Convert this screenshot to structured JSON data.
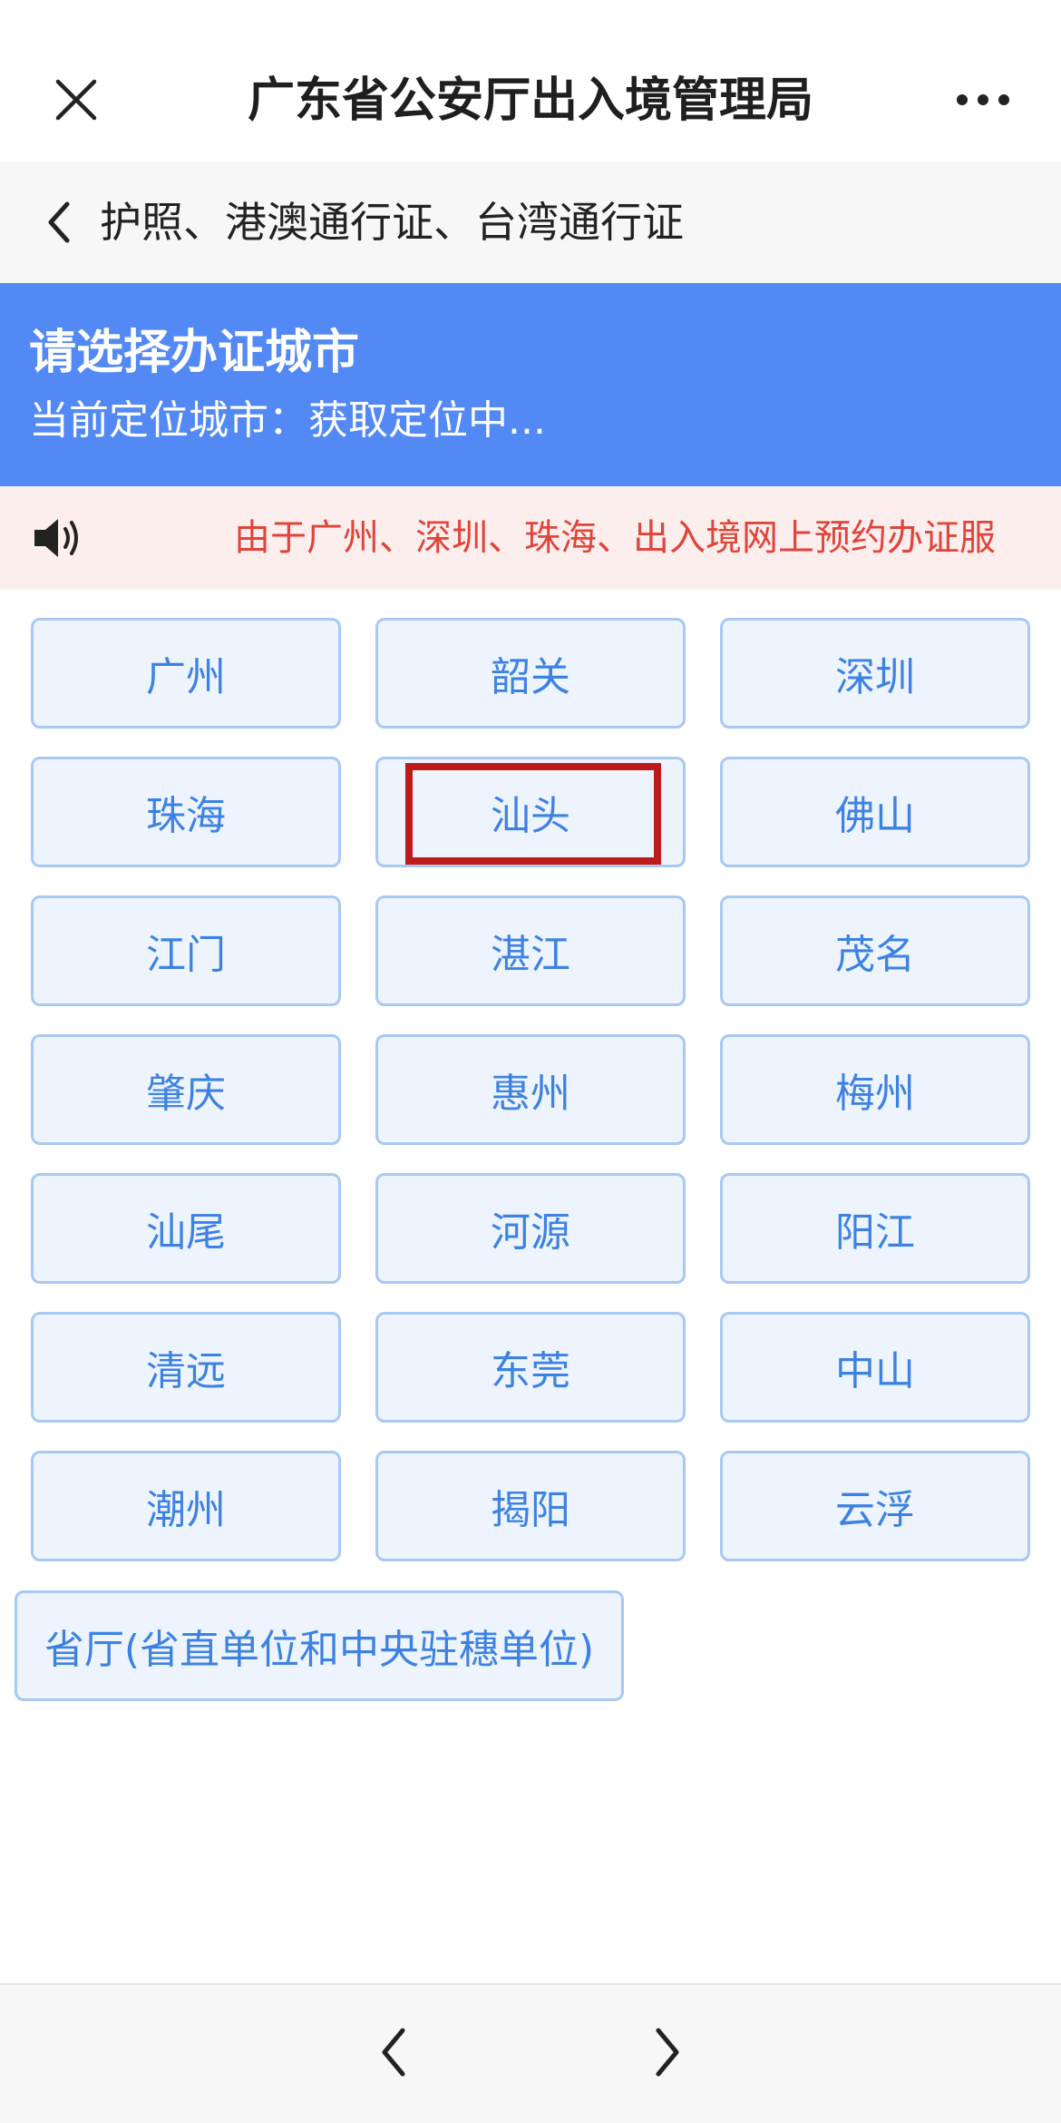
{
  "window": {
    "title": "广东省公安厅出入境管理局"
  },
  "subheader": {
    "title": "护照、港澳通行证、台湾通行证"
  },
  "banner": {
    "title": "请选择办证城市",
    "location_label": "当前定位城市：获取定位中..."
  },
  "notice": {
    "text": "由于广州、深圳、珠海、出入境网上预约办证服"
  },
  "cities": [
    {
      "label": "广州"
    },
    {
      "label": "韶关"
    },
    {
      "label": "深圳"
    },
    {
      "label": "珠海"
    },
    {
      "label": "汕头"
    },
    {
      "label": "佛山"
    },
    {
      "label": "江门"
    },
    {
      "label": "湛江"
    },
    {
      "label": "茂名"
    },
    {
      "label": "肇庆"
    },
    {
      "label": "惠州"
    },
    {
      "label": "梅州"
    },
    {
      "label": "汕尾"
    },
    {
      "label": "河源"
    },
    {
      "label": "阳江"
    },
    {
      "label": "清远"
    },
    {
      "label": "东莞"
    },
    {
      "label": "中山"
    },
    {
      "label": "潮州"
    },
    {
      "label": "揭阳"
    },
    {
      "label": "云浮"
    }
  ],
  "province_button": {
    "label": "省厅(省直单位和中央驻穗单位)"
  },
  "selected_city": "汕头",
  "colors": {
    "banner_blue": "#5289f5",
    "city_text": "#3d82e3",
    "city_bg": "#edf4fd",
    "city_border": "#a7c9f3",
    "notice_text": "#e0443a",
    "highlight": "#bf1a1a"
  },
  "icons": {
    "close": "close-icon",
    "more": "more-icon",
    "back": "chevron-left-icon",
    "notice": "speaker-icon",
    "nav_back": "chevron-left-icon",
    "nav_forward": "chevron-right-icon"
  }
}
